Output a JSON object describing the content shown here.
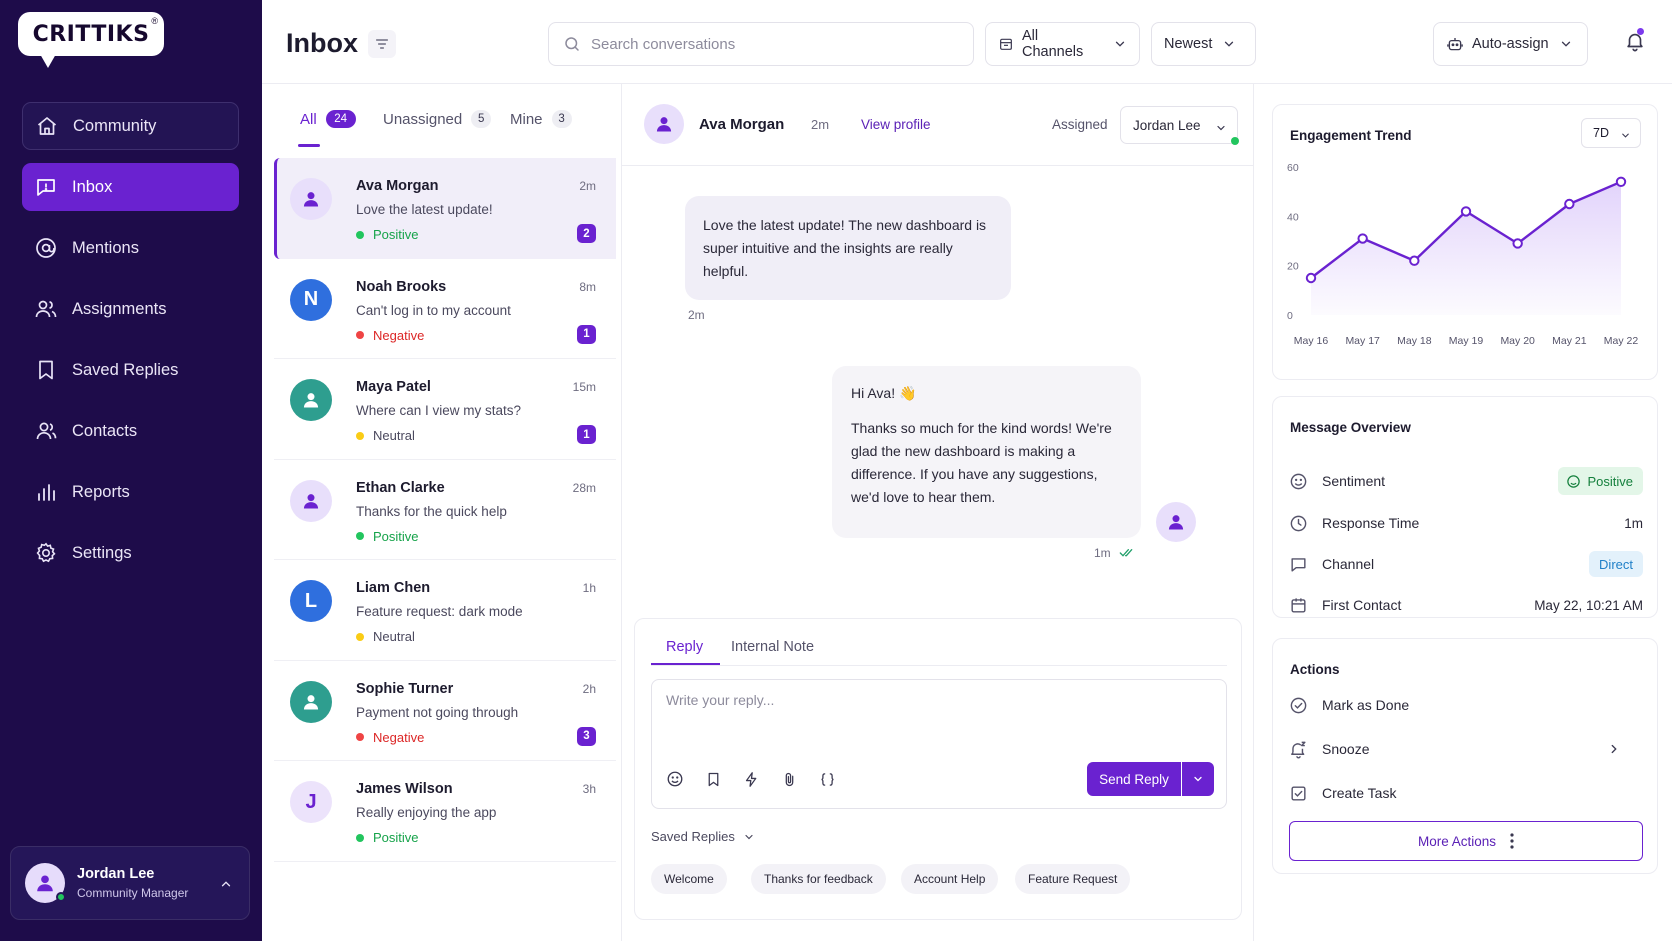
{
  "app": {
    "logo_text": "CRITTIKS",
    "logo_reg": "®"
  },
  "colors": {
    "sidebar_bg": "#1e0c4a",
    "accent": "#6a22d0",
    "positive": "#22c55e",
    "negative": "#ef4444",
    "neutral": "#facc15"
  },
  "sidebar": {
    "items": [
      {
        "label": "Community",
        "icon": "home-icon"
      },
      {
        "label": "Inbox",
        "icon": "inbox-icon",
        "active": true
      },
      {
        "label": "Mentions",
        "icon": "at-icon"
      },
      {
        "label": "Assignments",
        "icon": "users-icon"
      },
      {
        "label": "Saved Replies",
        "icon": "bookmark-icon"
      },
      {
        "label": "Contacts",
        "icon": "contacts-icon"
      },
      {
        "label": "Reports",
        "icon": "bar-chart-icon"
      },
      {
        "label": "Settings",
        "icon": "gear-icon"
      }
    ],
    "user": {
      "name": "Jordan Lee",
      "role": "Community Manager"
    }
  },
  "header": {
    "title": "Inbox",
    "search_placeholder": "Search conversations",
    "channels_label": "All Channels",
    "sort_label": "Newest",
    "auto_assign_label": "Auto-assign"
  },
  "tabs": [
    {
      "label": "All",
      "count": "24"
    },
    {
      "label": "Unassigned",
      "count": "5"
    },
    {
      "label": "Mine",
      "count": "3"
    }
  ],
  "conversations": [
    {
      "name": "Ava Morgan",
      "time": "2m",
      "preview": "Love the latest update!",
      "sentiment": "Positive",
      "badge": "2",
      "initial": "",
      "avatar": "purple-person"
    },
    {
      "name": "Noah Brooks",
      "time": "8m",
      "preview": "Can't log in to my account",
      "sentiment": "Negative",
      "badge": "1",
      "initial": "N",
      "avatar": "blue"
    },
    {
      "name": "Maya Patel",
      "time": "15m",
      "preview": "Where can I view my stats?",
      "sentiment": "Neutral",
      "badge": "1",
      "initial": "",
      "avatar": "teal-person"
    },
    {
      "name": "Ethan Clarke",
      "time": "28m",
      "preview": "Thanks for the quick help",
      "sentiment": "Positive",
      "badge": "",
      "initial": "",
      "avatar": "purple-person"
    },
    {
      "name": "Liam Chen",
      "time": "1h",
      "preview": "Feature request: dark mode",
      "sentiment": "Neutral",
      "badge": "",
      "initial": "L",
      "avatar": "blue"
    },
    {
      "name": "Sophie Turner",
      "time": "2h",
      "preview": "Payment not going through",
      "sentiment": "Negative",
      "badge": "3",
      "initial": "",
      "avatar": "teal-person"
    },
    {
      "name": "James Wilson",
      "time": "3h",
      "preview": "Really enjoying the app",
      "sentiment": "Positive",
      "badge": "",
      "initial": "J",
      "avatar": "lavender"
    }
  ],
  "chat": {
    "name": "Ava Morgan",
    "time": "2m",
    "view_profile": "View profile",
    "assigned_label": "Assigned",
    "assignee": "Jordan Lee",
    "incoming": {
      "text": "Love the latest update! The new dashboard is super intuitive and the insights are really helpful.",
      "time": "2m"
    },
    "outgoing": {
      "greeting": "Hi Ava! 👋",
      "text": "Thanks so much for the kind words! We're glad the new dashboard is making a difference. If you have any suggestions, we'd love to hear them.",
      "time": "1m"
    }
  },
  "composer": {
    "tab_reply": "Reply",
    "tab_note": "Internal Note",
    "placeholder": "Write your reply...",
    "send_label": "Send Reply",
    "saved_replies_label": "Saved Replies",
    "chips": [
      "Welcome",
      "Thanks for feedback",
      "Account Help",
      "Feature Request"
    ]
  },
  "engagement": {
    "title": "Engagement Trend",
    "range": "7D"
  },
  "chart_data": {
    "type": "line",
    "title": "Engagement Trend",
    "x": [
      "May 16",
      "May 17",
      "May 18",
      "May 19",
      "May 20",
      "May 21",
      "May 22"
    ],
    "series": [
      {
        "values": [
          15,
          31,
          22,
          42,
          29,
          45,
          54
        ]
      }
    ],
    "yticks": [
      "0",
      "20",
      "40",
      "60"
    ],
    "ylim": [
      0,
      60
    ],
    "grid": false,
    "area_fill": true
  },
  "overview": {
    "title": "Message Overview",
    "sentiment_label": "Sentiment",
    "sentiment_value": "Positive",
    "response_label": "Response Time",
    "response_value": "1m",
    "channel_label": "Channel",
    "channel_value": "Direct",
    "first_contact_label": "First Contact",
    "first_contact_value": "May 22, 10:21 AM"
  },
  "actions": {
    "title": "Actions",
    "mark_done": "Mark as Done",
    "snooze": "Snooze",
    "create_task": "Create Task",
    "more": "More Actions"
  }
}
